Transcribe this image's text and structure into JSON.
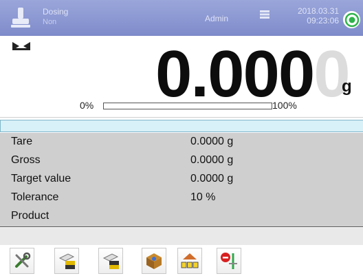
{
  "header": {
    "mode_name": "Dosing",
    "mode_sub": "Non",
    "user": "Admin",
    "datetime": "2018.03.31\n09:23:06",
    "status_color": "#2fb34a"
  },
  "display": {
    "value_main": "0.000",
    "value_last": "0",
    "unit": "g",
    "bar_min": "0%",
    "bar_max": "100%",
    "bar_fill_fraction": 0.0
  },
  "info": {
    "rows": [
      {
        "label": "Tare",
        "value": "0.0000 g"
      },
      {
        "label": "Gross",
        "value": "0.0000 g"
      },
      {
        "label": "Target value",
        "value": "0.0000 g"
      },
      {
        "label": "Tolerance",
        "value": "10 %"
      },
      {
        "label": "Product",
        "value": ""
      }
    ]
  },
  "toolbar": {
    "buttons": [
      {
        "icon": "settings-tools-icon"
      },
      {
        "icon": "tare-icon"
      },
      {
        "icon": "tare-clear-icon"
      },
      {
        "icon": "product-database-icon"
      },
      {
        "icon": "packages-icon"
      },
      {
        "icon": "stop-dosing-icon"
      }
    ]
  }
}
